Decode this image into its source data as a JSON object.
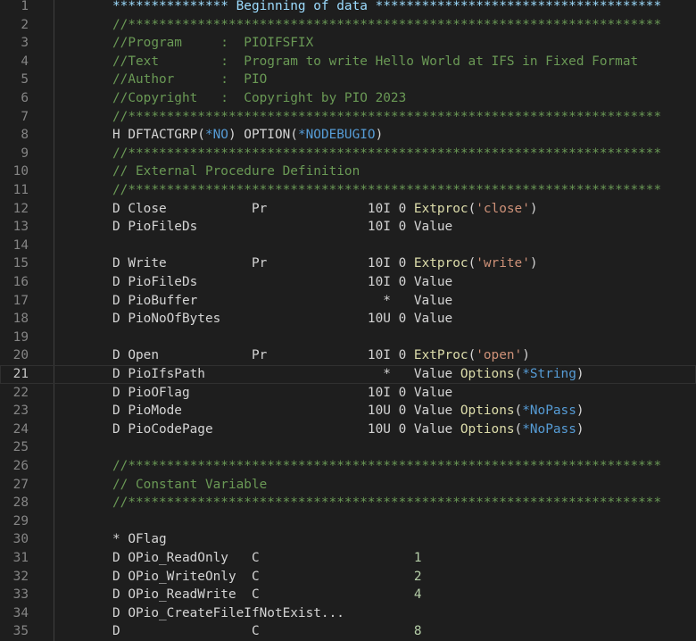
{
  "editor": {
    "current_line": 21,
    "lines": [
      {
        "n": "1",
        "tokens": [
          [
            "hdr",
            "*************** Beginning of data *************************************"
          ]
        ]
      },
      {
        "n": "2",
        "tokens": [
          [
            "cmt",
            "//*********************************************************************"
          ]
        ]
      },
      {
        "n": "3",
        "tokens": [
          [
            "cmt",
            "//Program     :  PIOIFSFIX"
          ]
        ]
      },
      {
        "n": "4",
        "tokens": [
          [
            "cmt",
            "//Text        :  Program to write Hello World at IFS in Fixed Format"
          ]
        ]
      },
      {
        "n": "5",
        "tokens": [
          [
            "cmt",
            "//Author      :  PIO"
          ]
        ]
      },
      {
        "n": "6",
        "tokens": [
          [
            "cmt",
            "//Copyright   :  Copyright by PIO 2023"
          ]
        ]
      },
      {
        "n": "7",
        "tokens": [
          [
            "cmt",
            "//*********************************************************************"
          ]
        ]
      },
      {
        "n": "8",
        "tokens": [
          [
            "pl",
            "H DFTACTGRP("
          ],
          [
            "con",
            "*NO"
          ],
          [
            "pl",
            ") OPTION("
          ],
          [
            "con",
            "*NODEBUGIO"
          ],
          [
            "pl",
            ")"
          ]
        ]
      },
      {
        "n": "9",
        "tokens": [
          [
            "cmt",
            "//*********************************************************************"
          ]
        ]
      },
      {
        "n": "10",
        "tokens": [
          [
            "cmt",
            "// External Procedure Definition"
          ]
        ]
      },
      {
        "n": "11",
        "tokens": [
          [
            "cmt",
            "//*********************************************************************"
          ]
        ]
      },
      {
        "n": "12",
        "tokens": [
          [
            "pl",
            "D Close           Pr             10I 0 "
          ],
          [
            "fn",
            "Extproc"
          ],
          [
            "pl",
            "("
          ],
          [
            "str",
            "'close'"
          ],
          [
            "pl",
            ")"
          ]
        ]
      },
      {
        "n": "13",
        "tokens": [
          [
            "pl",
            "D PioFileDs                      10I 0 Value"
          ]
        ]
      },
      {
        "n": "14",
        "tokens": []
      },
      {
        "n": "15",
        "tokens": [
          [
            "pl",
            "D Write           Pr             10I 0 "
          ],
          [
            "fn",
            "Extproc"
          ],
          [
            "pl",
            "("
          ],
          [
            "str",
            "'write'"
          ],
          [
            "pl",
            ")"
          ]
        ]
      },
      {
        "n": "16",
        "tokens": [
          [
            "pl",
            "D PioFileDs                      10I 0 Value"
          ]
        ]
      },
      {
        "n": "17",
        "tokens": [
          [
            "pl",
            "D PioBuffer                        *   Value"
          ]
        ]
      },
      {
        "n": "18",
        "tokens": [
          [
            "pl",
            "D PioNoOfBytes                   10U 0 Value"
          ]
        ]
      },
      {
        "n": "19",
        "tokens": []
      },
      {
        "n": "20",
        "tokens": [
          [
            "pl",
            "D Open            Pr             10I 0 "
          ],
          [
            "fn",
            "ExtProc"
          ],
          [
            "pl",
            "("
          ],
          [
            "str",
            "'open'"
          ],
          [
            "pl",
            ")"
          ]
        ]
      },
      {
        "n": "21",
        "tokens": [
          [
            "pl",
            "D PioIfsPath                       *   Value "
          ],
          [
            "fn",
            "Options"
          ],
          [
            "pl",
            "("
          ],
          [
            "con",
            "*String"
          ],
          [
            "pl",
            ")"
          ]
        ]
      },
      {
        "n": "22",
        "tokens": [
          [
            "pl",
            "D PioOFlag                       10I 0 Value"
          ]
        ]
      },
      {
        "n": "23",
        "tokens": [
          [
            "pl",
            "D PioMode                        10U 0 Value "
          ],
          [
            "fn",
            "Options"
          ],
          [
            "pl",
            "("
          ],
          [
            "con",
            "*NoPass"
          ],
          [
            "pl",
            ")"
          ]
        ]
      },
      {
        "n": "24",
        "tokens": [
          [
            "pl",
            "D PioCodePage                    10U 0 Value "
          ],
          [
            "fn",
            "Options"
          ],
          [
            "pl",
            "("
          ],
          [
            "con",
            "*NoPass"
          ],
          [
            "pl",
            ")"
          ]
        ]
      },
      {
        "n": "25",
        "tokens": []
      },
      {
        "n": "26",
        "tokens": [
          [
            "cmt",
            "//*********************************************************************"
          ]
        ]
      },
      {
        "n": "27",
        "tokens": [
          [
            "cmt",
            "// Constant Variable"
          ]
        ]
      },
      {
        "n": "28",
        "tokens": [
          [
            "cmt",
            "//*********************************************************************"
          ]
        ]
      },
      {
        "n": "29",
        "tokens": []
      },
      {
        "n": "30",
        "tokens": [
          [
            "pl",
            "* OFlag"
          ]
        ]
      },
      {
        "n": "31",
        "tokens": [
          [
            "pl",
            "D OPio_ReadOnly   C                    "
          ],
          [
            "num",
            "1"
          ]
        ]
      },
      {
        "n": "32",
        "tokens": [
          [
            "pl",
            "D OPio_WriteOnly  C                    "
          ],
          [
            "num",
            "2"
          ]
        ]
      },
      {
        "n": "33",
        "tokens": [
          [
            "pl",
            "D OPio_ReadWrite  C                    "
          ],
          [
            "num",
            "4"
          ]
        ]
      },
      {
        "n": "34",
        "tokens": [
          [
            "pl",
            "D OPio_CreateFileIfNotExist..."
          ]
        ]
      },
      {
        "n": "35",
        "tokens": [
          [
            "pl",
            "D                 C                    "
          ],
          [
            "num",
            "8"
          ]
        ]
      }
    ]
  }
}
